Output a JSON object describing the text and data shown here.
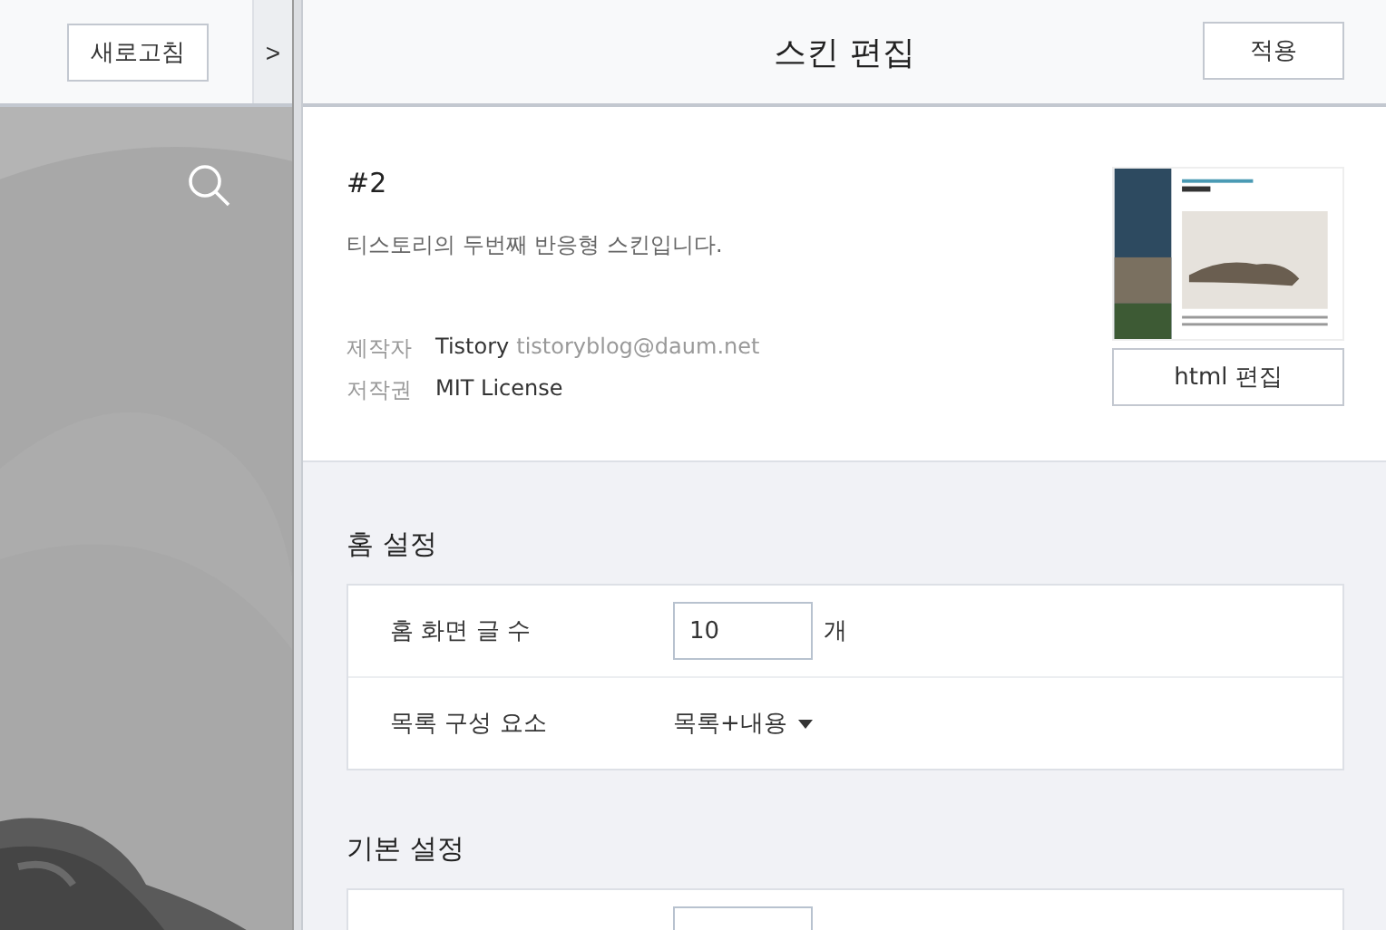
{
  "preview_toolbar": {
    "refresh_button": "새로고침",
    "toggle": ">"
  },
  "header": {
    "title": "스킨 편집",
    "apply_button": "적용"
  },
  "skin_info": {
    "name": "#2",
    "description": "티스토리의 두번째 반응형 스킨입니다.",
    "meta": [
      {
        "label": "제작자",
        "value": "Tistory",
        "extra": "tistoryblog@daum.net"
      },
      {
        "label": "저작권",
        "value": "MIT License"
      }
    ],
    "html_button": "html 편집"
  },
  "sections": [
    {
      "title": "홈 설정",
      "rows": [
        {
          "kind": "number",
          "label": "홈 화면 글 수",
          "value": "10",
          "unit": "개"
        },
        {
          "kind": "select",
          "label": "목록 구성 요소",
          "value": "목록+내용"
        }
      ]
    },
    {
      "title": "기본 설정",
      "rows": [
        {
          "kind": "number"
        }
      ]
    }
  ]
}
